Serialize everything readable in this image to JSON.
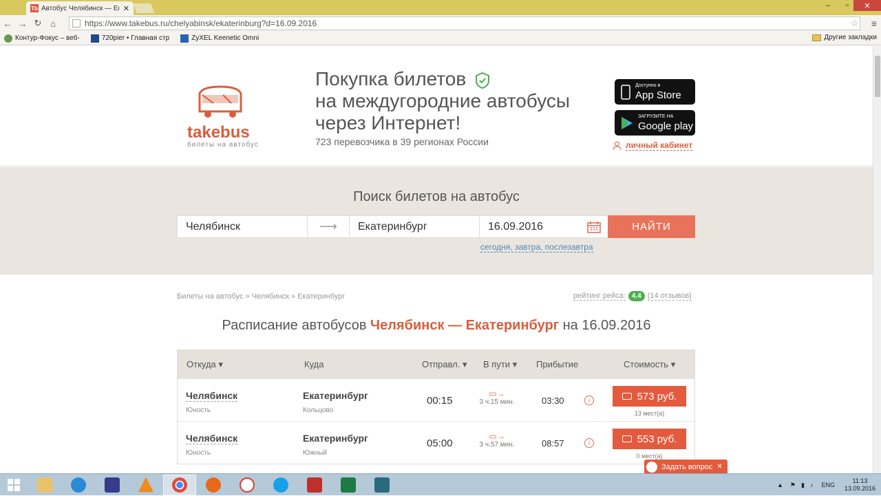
{
  "browser": {
    "tab_title": "Автобус Челябинск — Ек",
    "tab_favicon": "Tb",
    "url": "https://www.takebus.ru/chelyabinsk/ekaterinburg?d=16.09.2016",
    "bookmarks": [
      "Контур-Фокус – веб-",
      "720pier • Главная стр",
      "ZyXEL Keenetic Omni"
    ],
    "other_bookmarks": "Другие закладки"
  },
  "header": {
    "logo_name": "takebus",
    "logo_sub": "билеты на автобус",
    "title_line1": "Покупка билетов",
    "title_line2": "на междугородние автобусы",
    "title_line3": "через Интернет!",
    "subtitle": "723 перевозчика в 39 регионах России",
    "appstore_small": "Доступно в",
    "appstore_big": "App Store",
    "googleplay_small": "ЗАГРУЗИТЕ НА",
    "googleplay_big": "Google play",
    "cabinet": "личный кабинет"
  },
  "search": {
    "title": "Поиск билетов на автобус",
    "from": "Челябинск",
    "to": "Екатеринбург",
    "date": "16.09.2016",
    "button": "НАЙТИ",
    "quick_links": "сегодня, завтра, послезавтра"
  },
  "breadcrumbs": "Билеты на автобус » Челябинск » Екатеринбург",
  "rating": {
    "label": "рейтинг рейса:",
    "value": "4.4",
    "reviews": "(14 отзывов)"
  },
  "schedule": {
    "prefix": "Расписание автобусов",
    "route": "Челябинск — Екатеринбург",
    "suffix": "на 16.09.2016"
  },
  "table": {
    "headers": {
      "from": "Откуда",
      "to": "Куда",
      "depart": "Отправл.",
      "duration": "В пути",
      "arrive": "Прибытие",
      "price": "Стоимость"
    },
    "rows": [
      {
        "from": "Челябинск",
        "from_station": "Юность",
        "to": "Екатеринбург",
        "to_station": "Кольцово",
        "depart": "00:15",
        "duration": "3 ч.15 мин.",
        "arrive": "03:30",
        "price": "573 руб.",
        "seats": "13 мест(а)"
      },
      {
        "from": "Челябинск",
        "from_station": "Юность",
        "to": "Екатеринбург",
        "to_station": "Южный",
        "depart": "05:00",
        "duration": "3 ч.57 мин.",
        "arrive": "08:57",
        "price": "553 руб.",
        "seats": "0 мест(а)"
      }
    ]
  },
  "ask_widget": "Задать вопрос",
  "taskbar": {
    "lang": "ENG",
    "time": "11:13",
    "date": "13.09.2016"
  },
  "colors": {
    "accent": "#e45a3d",
    "brand": "#d75f3e",
    "link": "#4a88b8",
    "rating": "#4caf50"
  }
}
